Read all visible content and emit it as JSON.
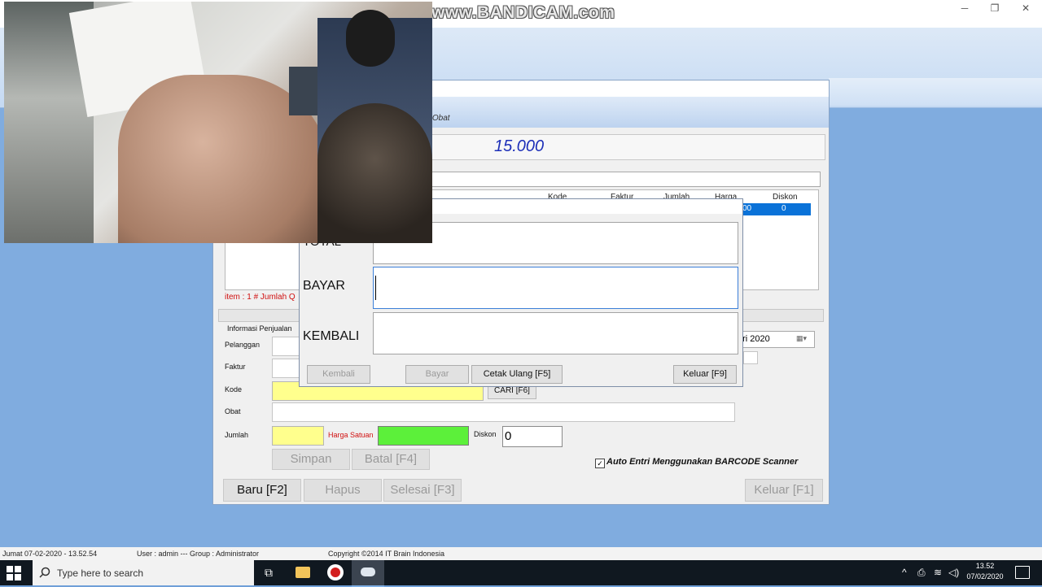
{
  "watermark": "www.BANDICAM.com",
  "window_controls": {
    "minimize": "─",
    "restore": "❐",
    "close": "✕"
  },
  "sales": {
    "title_fragment": "an Obat",
    "total_display": "15.000",
    "grid": {
      "headers": [
        "Kode",
        "Faktur",
        "Jumlah",
        "Harga",
        "Diskon"
      ],
      "selected_row": {
        "harga_fragment": "00",
        "diskon": "0"
      }
    },
    "item_info": "item : 1 # Jumlah Q",
    "info_group": "Informasi Penjualan",
    "labels": {
      "pelanggan": "Pelanggan",
      "faktur": "Faktur",
      "kode": "Kode",
      "obat": "Obat",
      "jumlah": "Jumlah",
      "harga_satuan": "Harga Satuan",
      "diskon": "Diskon"
    },
    "date_fragment": "ari  2020",
    "cari_label": "CARI [F6]",
    "diskon_value": "0",
    "buttons": {
      "simpan": "Simpan",
      "batal": "Batal [F4]",
      "baru": "Baru [F2]",
      "hapus": "Hapus",
      "selesai": "Selesai [F3]",
      "keluar": "Keluar [F1]"
    },
    "barcode_label": "Auto Entri Menggunakan BARCODE Scanner",
    "barcode_checked": true
  },
  "payment": {
    "labels": {
      "total_fragment": "TOTAL",
      "bayar": "BAYAR",
      "kembali": "KEMBALI"
    },
    "buttons": {
      "kembali": "Kembali",
      "bayar": "Bayar",
      "cetak_ulang": "Cetak Ulang [F5]",
      "keluar": "Keluar [F9]"
    }
  },
  "status_bar": {
    "date": "Jumat  07-02-2020 - 13.52.54",
    "user": "User : admin  --- Group  : Administrator",
    "copyright": "Copyright ©2014 IT Brain Indonesia"
  },
  "taskbar": {
    "search_placeholder": "Type here to search",
    "time": "13.52",
    "date": "07/02/2020"
  },
  "colors": {
    "total_text": "#1d2fb8",
    "item_info": "#d01010",
    "kode_field": "#ffff8d",
    "harga_field": "#5cf03a",
    "grid_selection": "#0a72d8"
  }
}
